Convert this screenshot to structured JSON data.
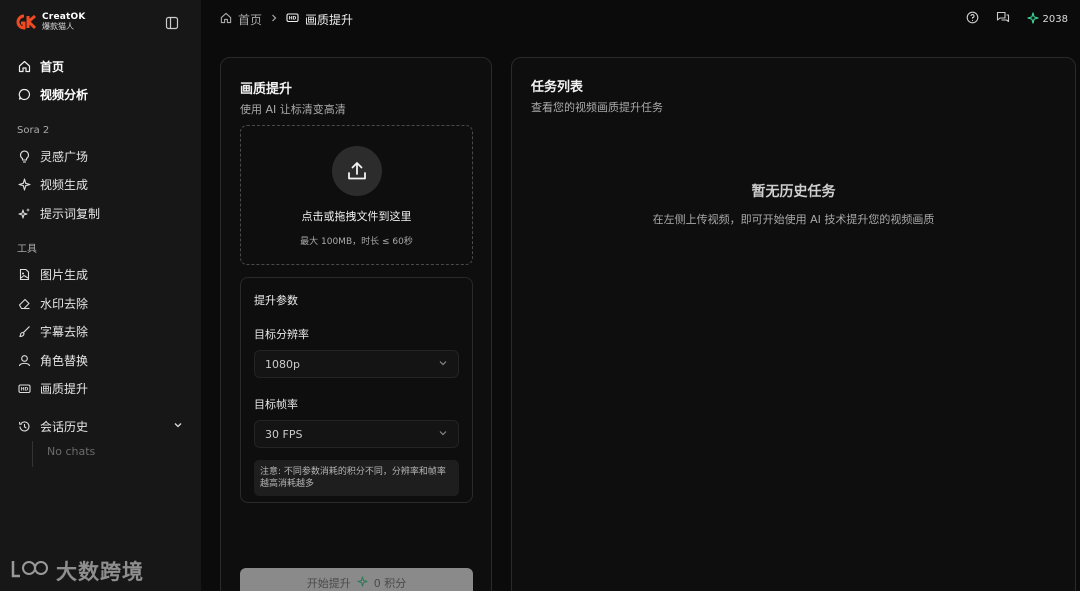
{
  "brand": {
    "name": "CreatOK",
    "subtitle": "爆款猫人"
  },
  "sidebar": {
    "top_items": [
      {
        "label": "首页",
        "icon": "home-icon"
      },
      {
        "label": "视频分析",
        "icon": "chat-bubble-icon"
      }
    ],
    "section_sora": "Sora 2",
    "sora_items": [
      {
        "label": "灵感广场",
        "icon": "lightbulb-icon"
      },
      {
        "label": "视频生成",
        "icon": "sparkle-icon"
      },
      {
        "label": "提示词复制",
        "icon": "sparkles-icon"
      }
    ],
    "section_tools": "工具",
    "tool_items": [
      {
        "label": "图片生成",
        "icon": "image-file-icon"
      },
      {
        "label": "水印去除",
        "icon": "eraser-icon"
      },
      {
        "label": "字幕去除",
        "icon": "brush-icon"
      },
      {
        "label": "角色替换",
        "icon": "user-icon"
      },
      {
        "label": "画质提升",
        "icon": "hd-icon"
      }
    ],
    "history_label": "会话历史",
    "no_chats": "No chats"
  },
  "watermark": {
    "logo_text": "LC",
    "text": "大数跨境"
  },
  "topbar": {
    "breadcrumb_home": "首页",
    "breadcrumb_current": "画质提升",
    "credits": "2038"
  },
  "left_panel": {
    "title": "画质提升",
    "subtitle": "使用 AI 让标清变高清",
    "upload_title": "点击或拖拽文件到这里",
    "upload_hint": "最大 100MB，时长 ≤ 60秒",
    "params_title": "提升参数",
    "resolution_label": "目标分辨率",
    "resolution_value": "1080p",
    "fps_label": "目标帧率",
    "fps_value": "30 FPS",
    "note": "注意: 不同参数消耗的积分不同，分辨率和帧率越高消耗越多",
    "start_label": "开始提升",
    "start_cost": "0 积分"
  },
  "right_panel": {
    "title": "任务列表",
    "subtitle": "查看您的视频画质提升任务",
    "empty_title": "暂无历史任务",
    "empty_desc": "在左侧上传视频，即可开始使用 AI 技术提升您的视频画质"
  },
  "colors": {
    "accent_green": "#3ddc97",
    "brand_orange": "#f04a23"
  }
}
